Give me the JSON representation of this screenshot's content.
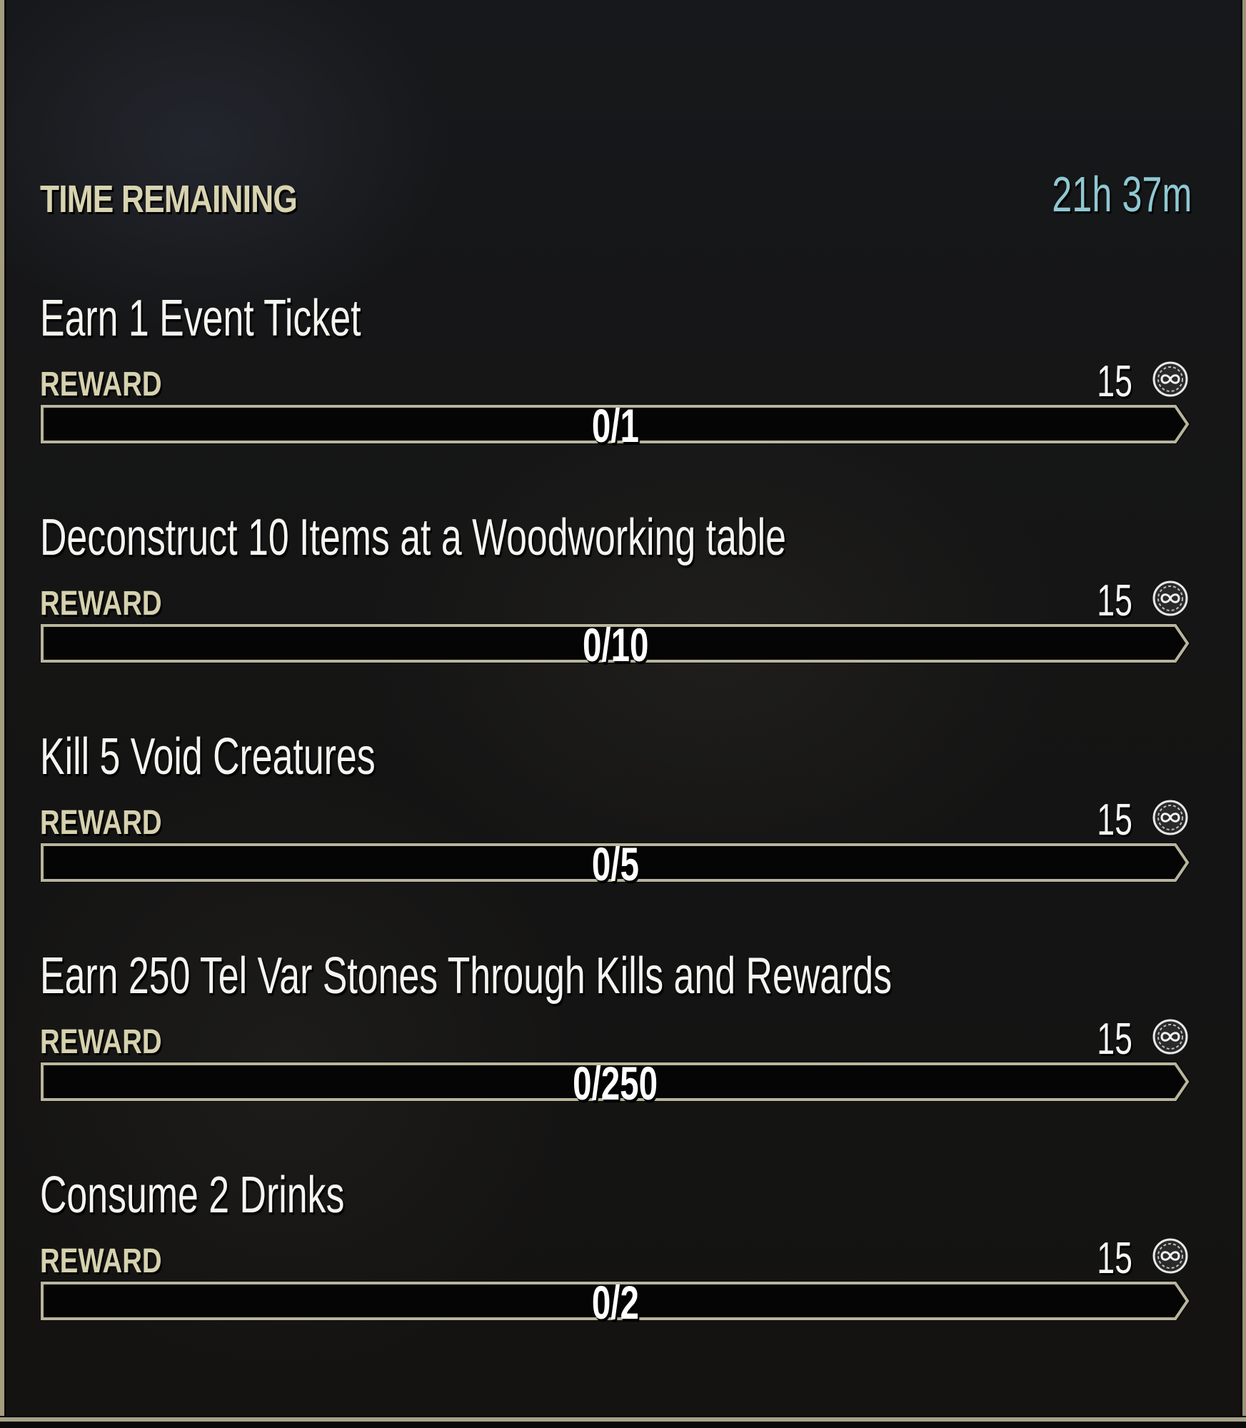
{
  "header": {
    "time_remaining_label": "TIME REMAINING",
    "time_remaining_value": "21h 37m"
  },
  "colors": {
    "label_tan": "#d8d3b0",
    "time_cyan": "#8fc8d2",
    "bar_border": "#b9b59c",
    "bar_fill": "#050505"
  },
  "quests": [
    {
      "title": "Earn 1 Event Ticket",
      "reward_label": "REWARD",
      "reward_amount": "15",
      "reward_icon": "event-ticket-coin-icon",
      "progress_text": "0/1",
      "progress": 0,
      "target": 1
    },
    {
      "title": "Deconstruct 10 Items at a Woodworking table",
      "reward_label": "REWARD",
      "reward_amount": "15",
      "reward_icon": "event-ticket-coin-icon",
      "progress_text": "0/10",
      "progress": 0,
      "target": 10
    },
    {
      "title": "Kill 5 Void Creatures",
      "reward_label": "REWARD",
      "reward_amount": "15",
      "reward_icon": "event-ticket-coin-icon",
      "progress_text": "0/5",
      "progress": 0,
      "target": 5
    },
    {
      "title": "Earn 250 Tel Var Stones Through Kills and Rewards",
      "reward_label": "REWARD",
      "reward_amount": "15",
      "reward_icon": "event-ticket-coin-icon",
      "progress_text": "0/250",
      "progress": 0,
      "target": 250
    },
    {
      "title": "Consume 2 Drinks",
      "reward_label": "REWARD",
      "reward_amount": "15",
      "reward_icon": "event-ticket-coin-icon",
      "progress_text": "0/2",
      "progress": 0,
      "target": 2
    }
  ]
}
